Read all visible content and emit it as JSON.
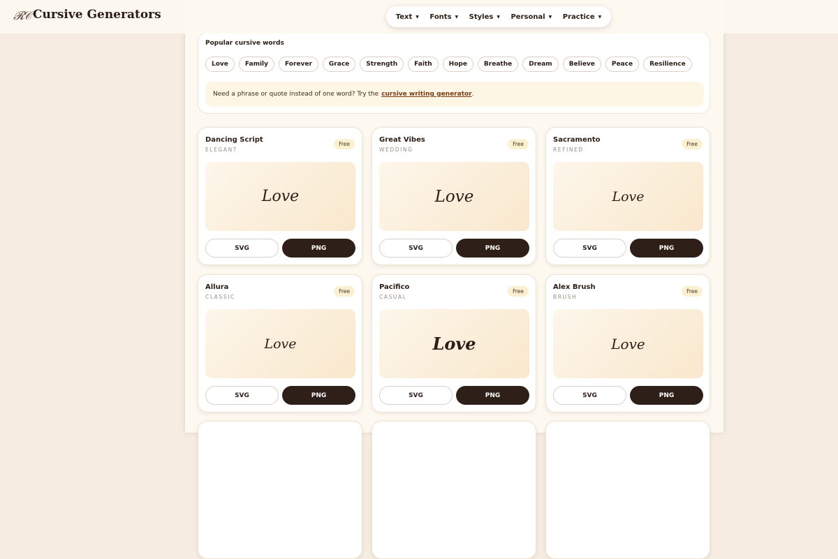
{
  "header": {
    "logo_mark": "𝓡𝒞",
    "site_title": "Cursive Generators",
    "nav": [
      "Text",
      "Fonts",
      "Styles",
      "Personal",
      "Practice"
    ]
  },
  "popular": {
    "title": "Popular cursive words",
    "words": [
      "Love",
      "Family",
      "Forever",
      "Grace",
      "Strength",
      "Faith",
      "Hope",
      "Breathe",
      "Dream",
      "Believe",
      "Peace",
      "Resilience"
    ],
    "hint_text": "Need a phrase or quote instead of one word? Try the",
    "hint_link": "cursive writing generator",
    "hint_end": "."
  },
  "cards": [
    {
      "name": "Dancing Script",
      "style": "ELEGANT",
      "badge": "Free",
      "preview": "Love",
      "svg": "SVG",
      "png": "PNG"
    },
    {
      "name": "Great Vibes",
      "style": "WEDDING",
      "badge": "Free",
      "preview": "Love",
      "svg": "SVG",
      "png": "PNG"
    },
    {
      "name": "Sacramento",
      "style": "REFINED",
      "badge": "Free",
      "preview": "Love",
      "svg": "SVG",
      "png": "PNG"
    },
    {
      "name": "Allura",
      "style": "CLASSIC",
      "badge": "Free",
      "preview": "Love",
      "svg": "SVG",
      "png": "PNG"
    },
    {
      "name": "Pacifico",
      "style": "CASUAL",
      "badge": "Free",
      "preview": "Love",
      "svg": "SVG",
      "png": "PNG"
    },
    {
      "name": "Alex Brush",
      "style": "BRUSH",
      "badge": "Free",
      "preview": "Love",
      "svg": "SVG",
      "png": "PNG"
    }
  ],
  "colors": {
    "accent": "#2e1f18",
    "badge_bg": "#fbf0cf",
    "page_bg": "#f6ece1",
    "link": "#7a3a12"
  }
}
